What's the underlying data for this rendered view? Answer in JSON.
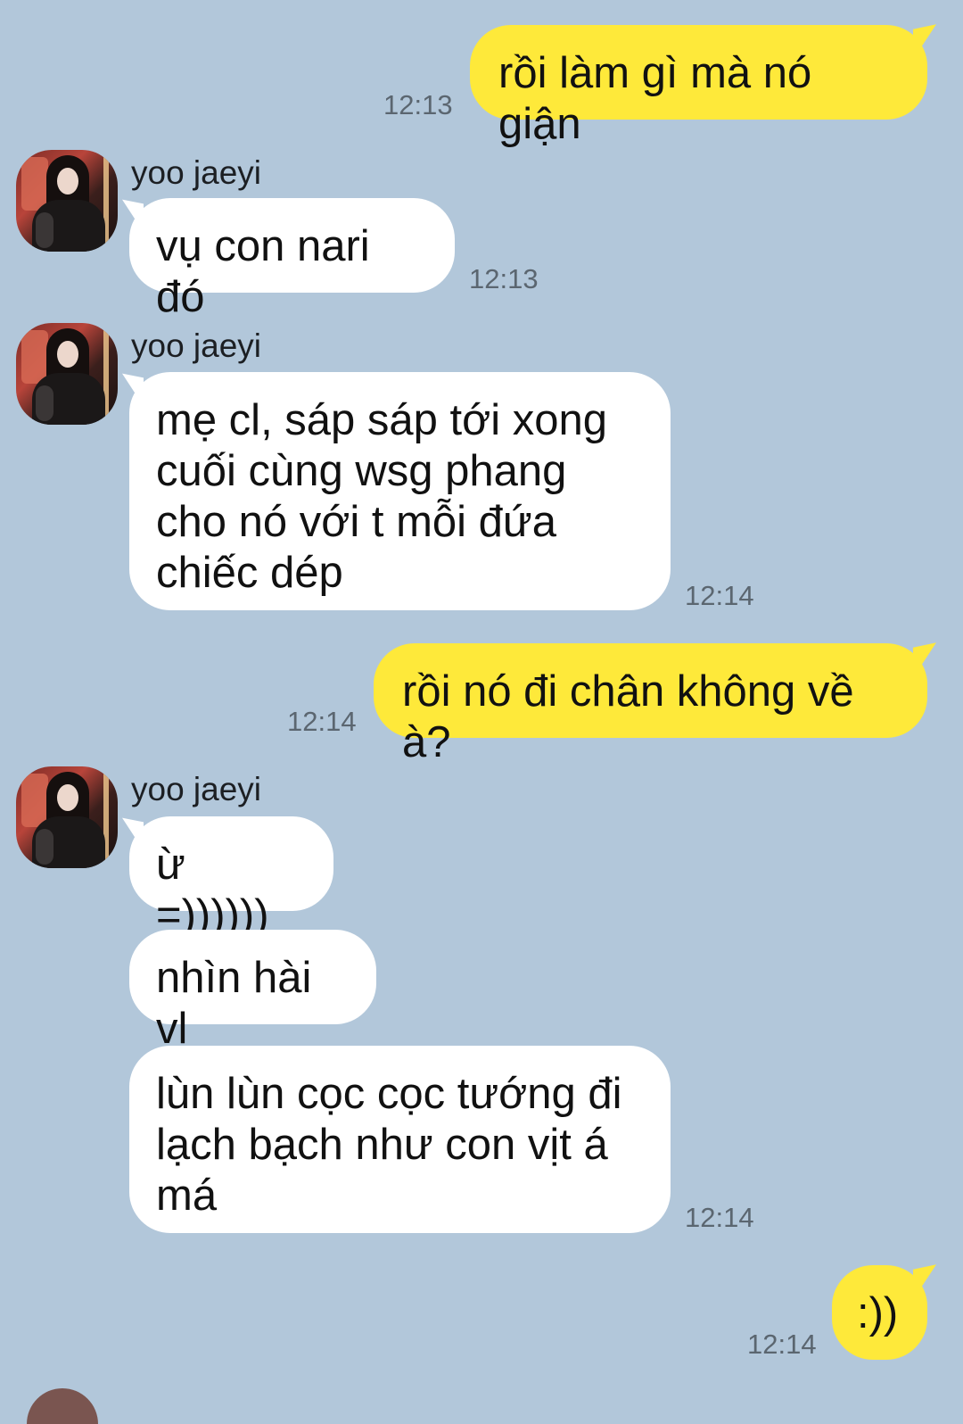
{
  "messages": [
    {
      "sender": "me",
      "text": "rồi làm gì mà nó giận",
      "time": "12:13"
    },
    {
      "sender": "yoo jaeyi",
      "text": "vụ con nari đó",
      "time": "12:13"
    },
    {
      "sender": "yoo jaeyi",
      "text": "mẹ cl, sáp sáp tới xong\ncuối cùng wsg phang\ncho nó với t mỗi đứa\nchiếc dép",
      "time": "12:14"
    },
    {
      "sender": "me",
      "text": "rồi nó đi chân không về à?",
      "time": "12:14"
    },
    {
      "sender": "yoo jaeyi",
      "text": "ừ =))))))",
      "time": ""
    },
    {
      "sender": "yoo jaeyi",
      "text": "nhìn hài vl",
      "time": ""
    },
    {
      "sender": "yoo jaeyi",
      "text": "lùn lùn cọc cọc tướng đi\nlạch bạch như con vịt á\nmá",
      "time": "12:14"
    },
    {
      "sender": "me",
      "text": ":))",
      "time": "12:14"
    }
  ],
  "contact": {
    "name": "yoo jaeyi"
  },
  "colors": {
    "background": "#B2C7DA",
    "my_bubble": "#FEE93A",
    "their_bubble": "#FFFFFF",
    "time_text": "#5B6670"
  }
}
